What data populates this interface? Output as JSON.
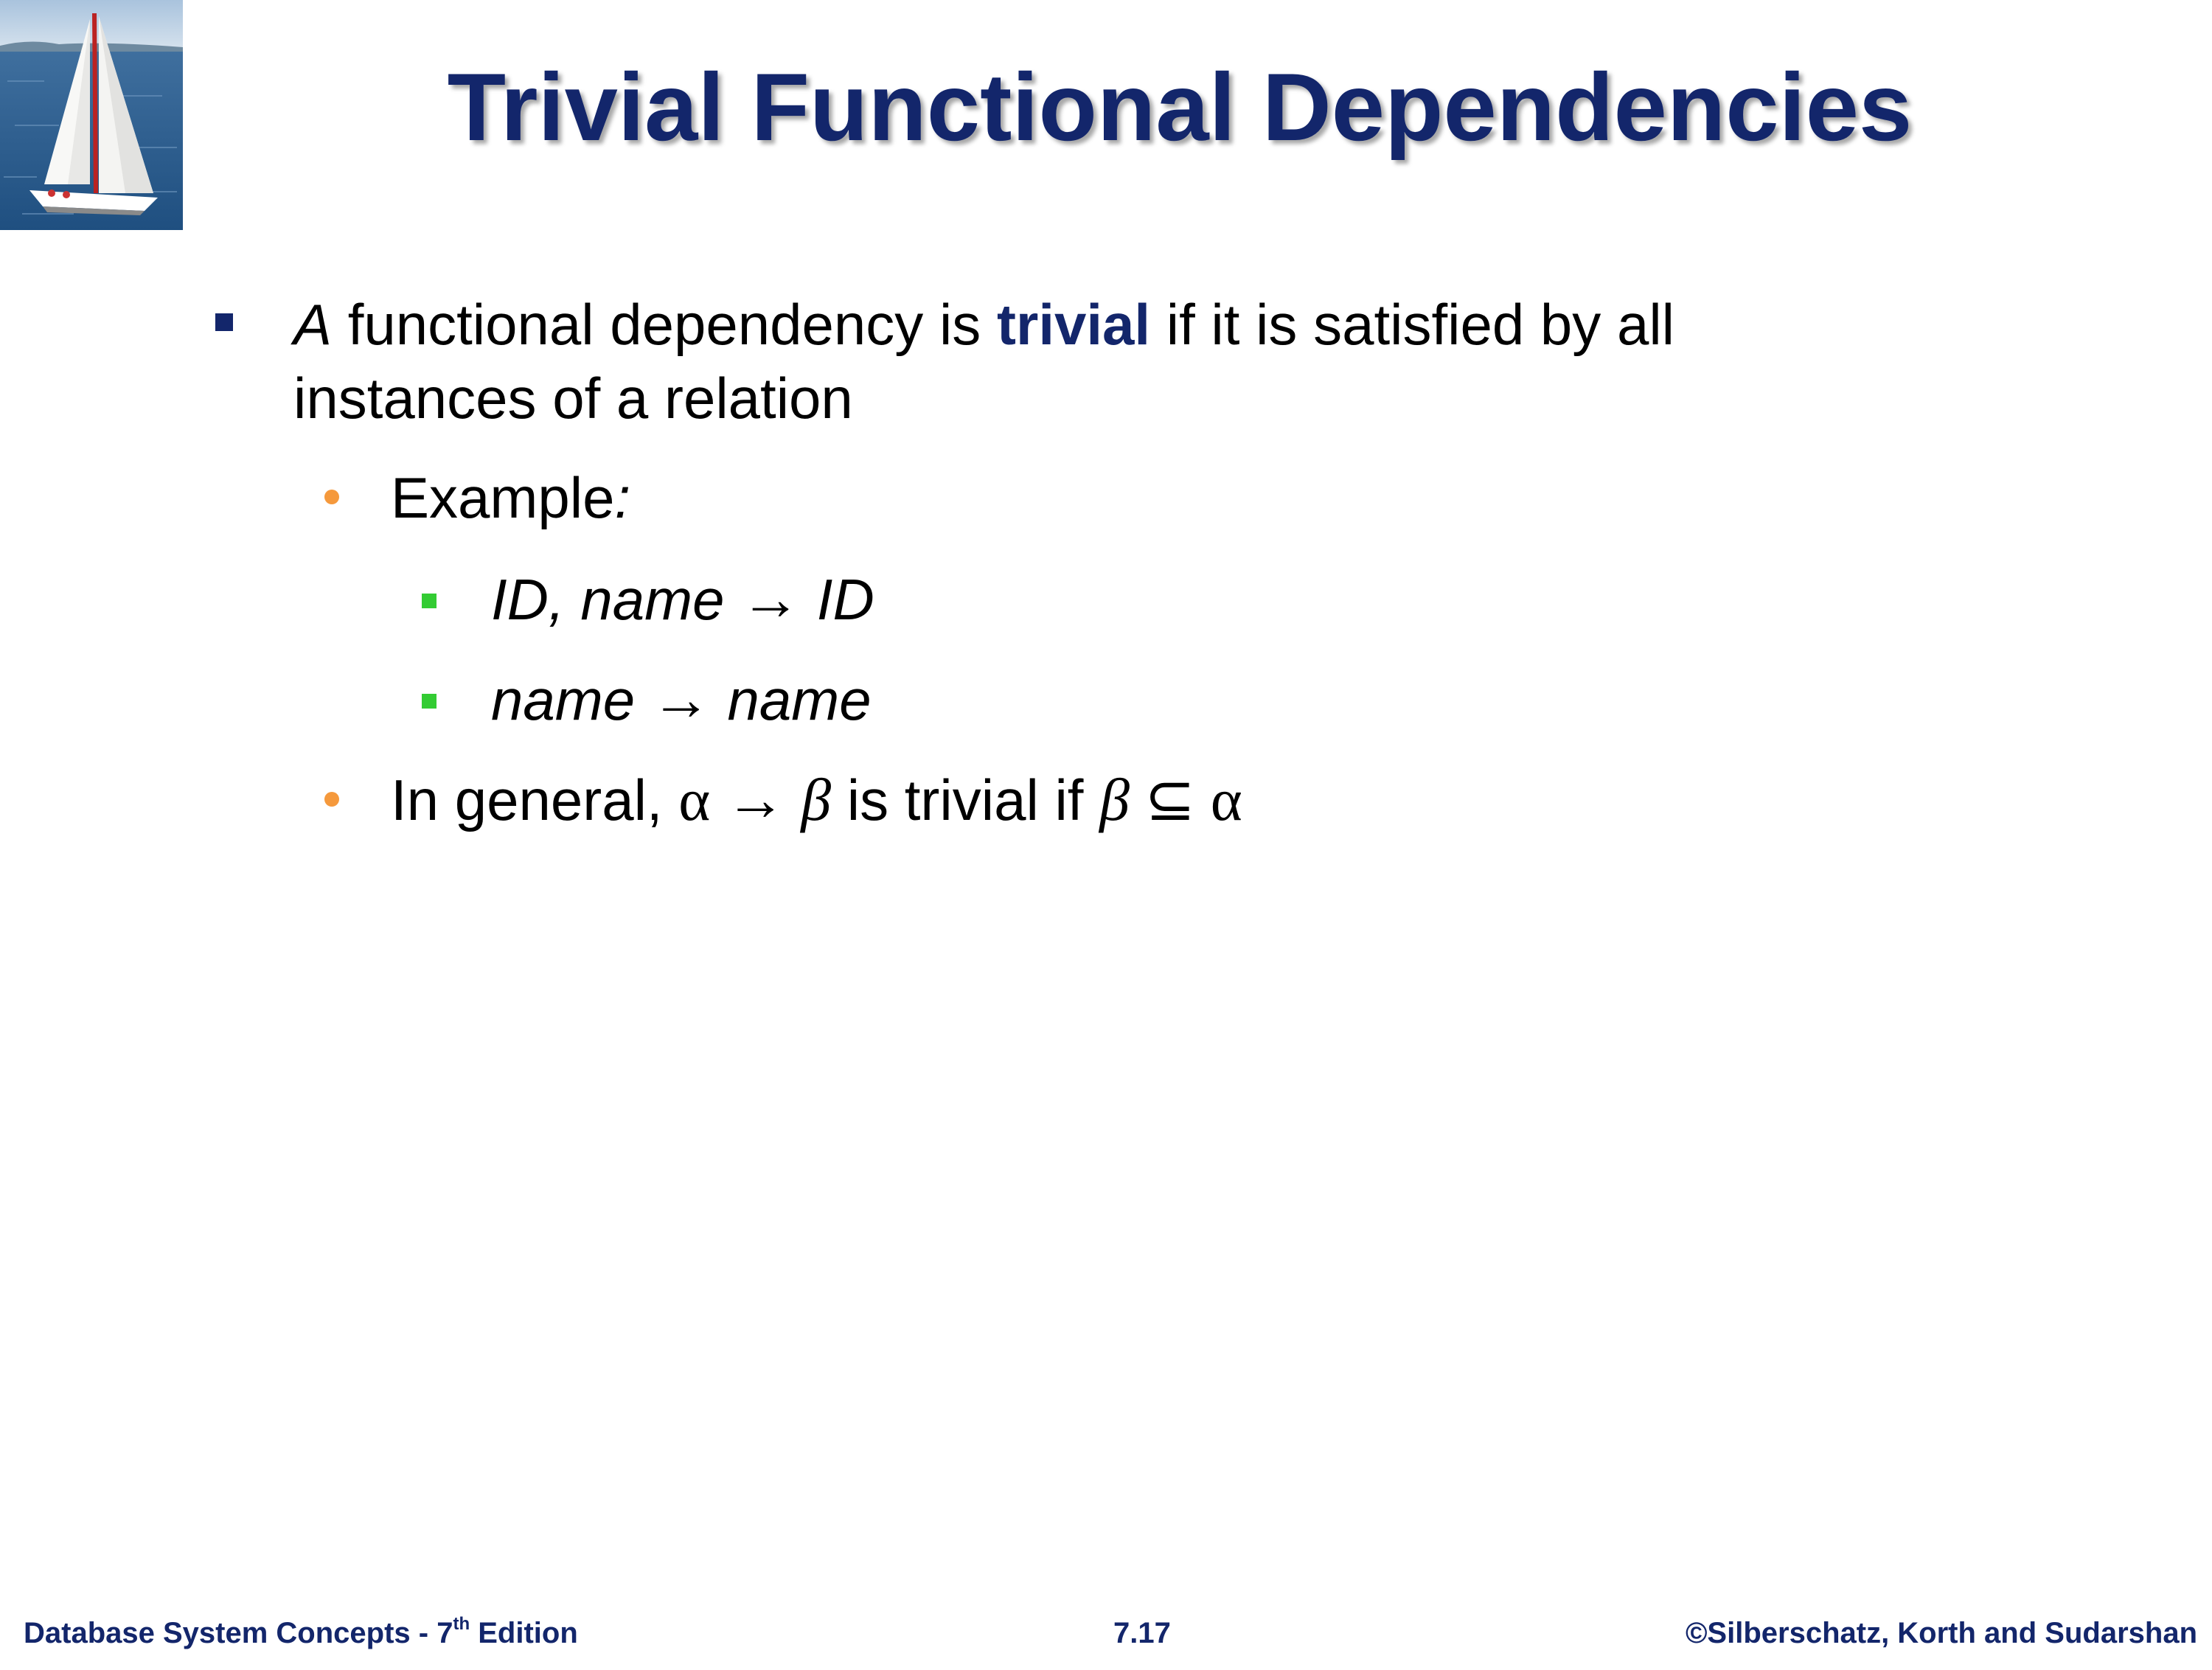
{
  "slide": {
    "title": "Trivial Functional Dependencies",
    "bullet1": {
      "prefix_italic": "A",
      "text_before": " functional dependency is ",
      "keyword": "trivial",
      "text_after": " if it is satisfied by all",
      "line2": "instances of a relation"
    },
    "sub1": {
      "label": "Example",
      "colon": ":"
    },
    "examples": [
      {
        "lhs": "ID, name ",
        "arrow": "→",
        "rhs": " ID"
      },
      {
        "lhs": "name ",
        "arrow": "→",
        "rhs": " name"
      }
    ],
    "sub2": {
      "text1": "In general, ",
      "alpha1": "α",
      "arrow": " → ",
      "beta1": "β",
      "text2": " is trivial if ",
      "beta2": "β",
      "subset": " ⊆ ",
      "alpha2": "α"
    }
  },
  "footer": {
    "left_main": "Database System Concepts - 7",
    "left_sup": "th",
    "left_end": " Edition",
    "center": "7.17",
    "right": "©Silberschatz, Korth and Sudarshan"
  },
  "colors": {
    "title": "#13266b",
    "keyword": "#13266b",
    "bullet_level1": "#13266b",
    "bullet_level2": "#f5993c",
    "bullet_level3": "#33cc33"
  },
  "logo": {
    "icon": "sailboat-icon"
  }
}
